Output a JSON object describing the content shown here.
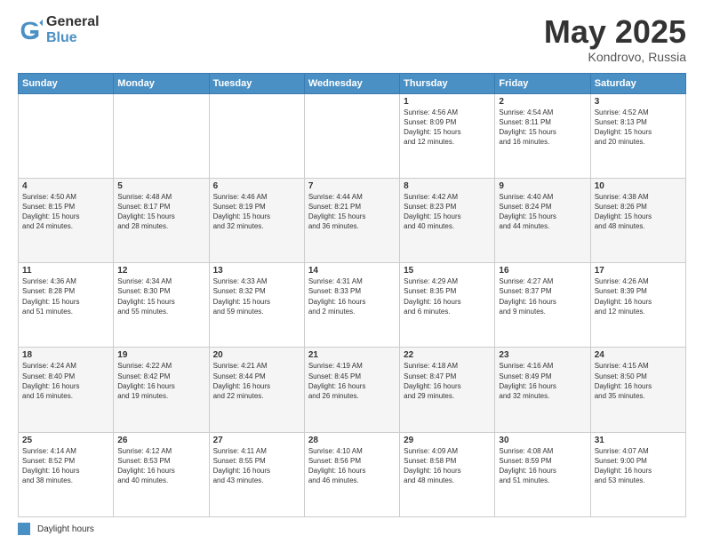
{
  "logo": {
    "general": "General",
    "blue": "Blue"
  },
  "title": {
    "month": "May 2025",
    "location": "Kondrovo, Russia"
  },
  "days_of_week": [
    "Sunday",
    "Monday",
    "Tuesday",
    "Wednesday",
    "Thursday",
    "Friday",
    "Saturday"
  ],
  "footer": {
    "legend_label": "Daylight hours"
  },
  "weeks": [
    {
      "days": [
        {
          "num": "",
          "info": ""
        },
        {
          "num": "",
          "info": ""
        },
        {
          "num": "",
          "info": ""
        },
        {
          "num": "",
          "info": ""
        },
        {
          "num": "1",
          "info": "Sunrise: 4:56 AM\nSunset: 8:09 PM\nDaylight: 15 hours\nand 12 minutes."
        },
        {
          "num": "2",
          "info": "Sunrise: 4:54 AM\nSunset: 8:11 PM\nDaylight: 15 hours\nand 16 minutes."
        },
        {
          "num": "3",
          "info": "Sunrise: 4:52 AM\nSunset: 8:13 PM\nDaylight: 15 hours\nand 20 minutes."
        }
      ]
    },
    {
      "days": [
        {
          "num": "4",
          "info": "Sunrise: 4:50 AM\nSunset: 8:15 PM\nDaylight: 15 hours\nand 24 minutes."
        },
        {
          "num": "5",
          "info": "Sunrise: 4:48 AM\nSunset: 8:17 PM\nDaylight: 15 hours\nand 28 minutes."
        },
        {
          "num": "6",
          "info": "Sunrise: 4:46 AM\nSunset: 8:19 PM\nDaylight: 15 hours\nand 32 minutes."
        },
        {
          "num": "7",
          "info": "Sunrise: 4:44 AM\nSunset: 8:21 PM\nDaylight: 15 hours\nand 36 minutes."
        },
        {
          "num": "8",
          "info": "Sunrise: 4:42 AM\nSunset: 8:23 PM\nDaylight: 15 hours\nand 40 minutes."
        },
        {
          "num": "9",
          "info": "Sunrise: 4:40 AM\nSunset: 8:24 PM\nDaylight: 15 hours\nand 44 minutes."
        },
        {
          "num": "10",
          "info": "Sunrise: 4:38 AM\nSunset: 8:26 PM\nDaylight: 15 hours\nand 48 minutes."
        }
      ]
    },
    {
      "days": [
        {
          "num": "11",
          "info": "Sunrise: 4:36 AM\nSunset: 8:28 PM\nDaylight: 15 hours\nand 51 minutes."
        },
        {
          "num": "12",
          "info": "Sunrise: 4:34 AM\nSunset: 8:30 PM\nDaylight: 15 hours\nand 55 minutes."
        },
        {
          "num": "13",
          "info": "Sunrise: 4:33 AM\nSunset: 8:32 PM\nDaylight: 15 hours\nand 59 minutes."
        },
        {
          "num": "14",
          "info": "Sunrise: 4:31 AM\nSunset: 8:33 PM\nDaylight: 16 hours\nand 2 minutes."
        },
        {
          "num": "15",
          "info": "Sunrise: 4:29 AM\nSunset: 8:35 PM\nDaylight: 16 hours\nand 6 minutes."
        },
        {
          "num": "16",
          "info": "Sunrise: 4:27 AM\nSunset: 8:37 PM\nDaylight: 16 hours\nand 9 minutes."
        },
        {
          "num": "17",
          "info": "Sunrise: 4:26 AM\nSunset: 8:39 PM\nDaylight: 16 hours\nand 12 minutes."
        }
      ]
    },
    {
      "days": [
        {
          "num": "18",
          "info": "Sunrise: 4:24 AM\nSunset: 8:40 PM\nDaylight: 16 hours\nand 16 minutes."
        },
        {
          "num": "19",
          "info": "Sunrise: 4:22 AM\nSunset: 8:42 PM\nDaylight: 16 hours\nand 19 minutes."
        },
        {
          "num": "20",
          "info": "Sunrise: 4:21 AM\nSunset: 8:44 PM\nDaylight: 16 hours\nand 22 minutes."
        },
        {
          "num": "21",
          "info": "Sunrise: 4:19 AM\nSunset: 8:45 PM\nDaylight: 16 hours\nand 26 minutes."
        },
        {
          "num": "22",
          "info": "Sunrise: 4:18 AM\nSunset: 8:47 PM\nDaylight: 16 hours\nand 29 minutes."
        },
        {
          "num": "23",
          "info": "Sunrise: 4:16 AM\nSunset: 8:49 PM\nDaylight: 16 hours\nand 32 minutes."
        },
        {
          "num": "24",
          "info": "Sunrise: 4:15 AM\nSunset: 8:50 PM\nDaylight: 16 hours\nand 35 minutes."
        }
      ]
    },
    {
      "days": [
        {
          "num": "25",
          "info": "Sunrise: 4:14 AM\nSunset: 8:52 PM\nDaylight: 16 hours\nand 38 minutes."
        },
        {
          "num": "26",
          "info": "Sunrise: 4:12 AM\nSunset: 8:53 PM\nDaylight: 16 hours\nand 40 minutes."
        },
        {
          "num": "27",
          "info": "Sunrise: 4:11 AM\nSunset: 8:55 PM\nDaylight: 16 hours\nand 43 minutes."
        },
        {
          "num": "28",
          "info": "Sunrise: 4:10 AM\nSunset: 8:56 PM\nDaylight: 16 hours\nand 46 minutes."
        },
        {
          "num": "29",
          "info": "Sunrise: 4:09 AM\nSunset: 8:58 PM\nDaylight: 16 hours\nand 48 minutes."
        },
        {
          "num": "30",
          "info": "Sunrise: 4:08 AM\nSunset: 8:59 PM\nDaylight: 16 hours\nand 51 minutes."
        },
        {
          "num": "31",
          "info": "Sunrise: 4:07 AM\nSunset: 9:00 PM\nDaylight: 16 hours\nand 53 minutes."
        }
      ]
    }
  ]
}
